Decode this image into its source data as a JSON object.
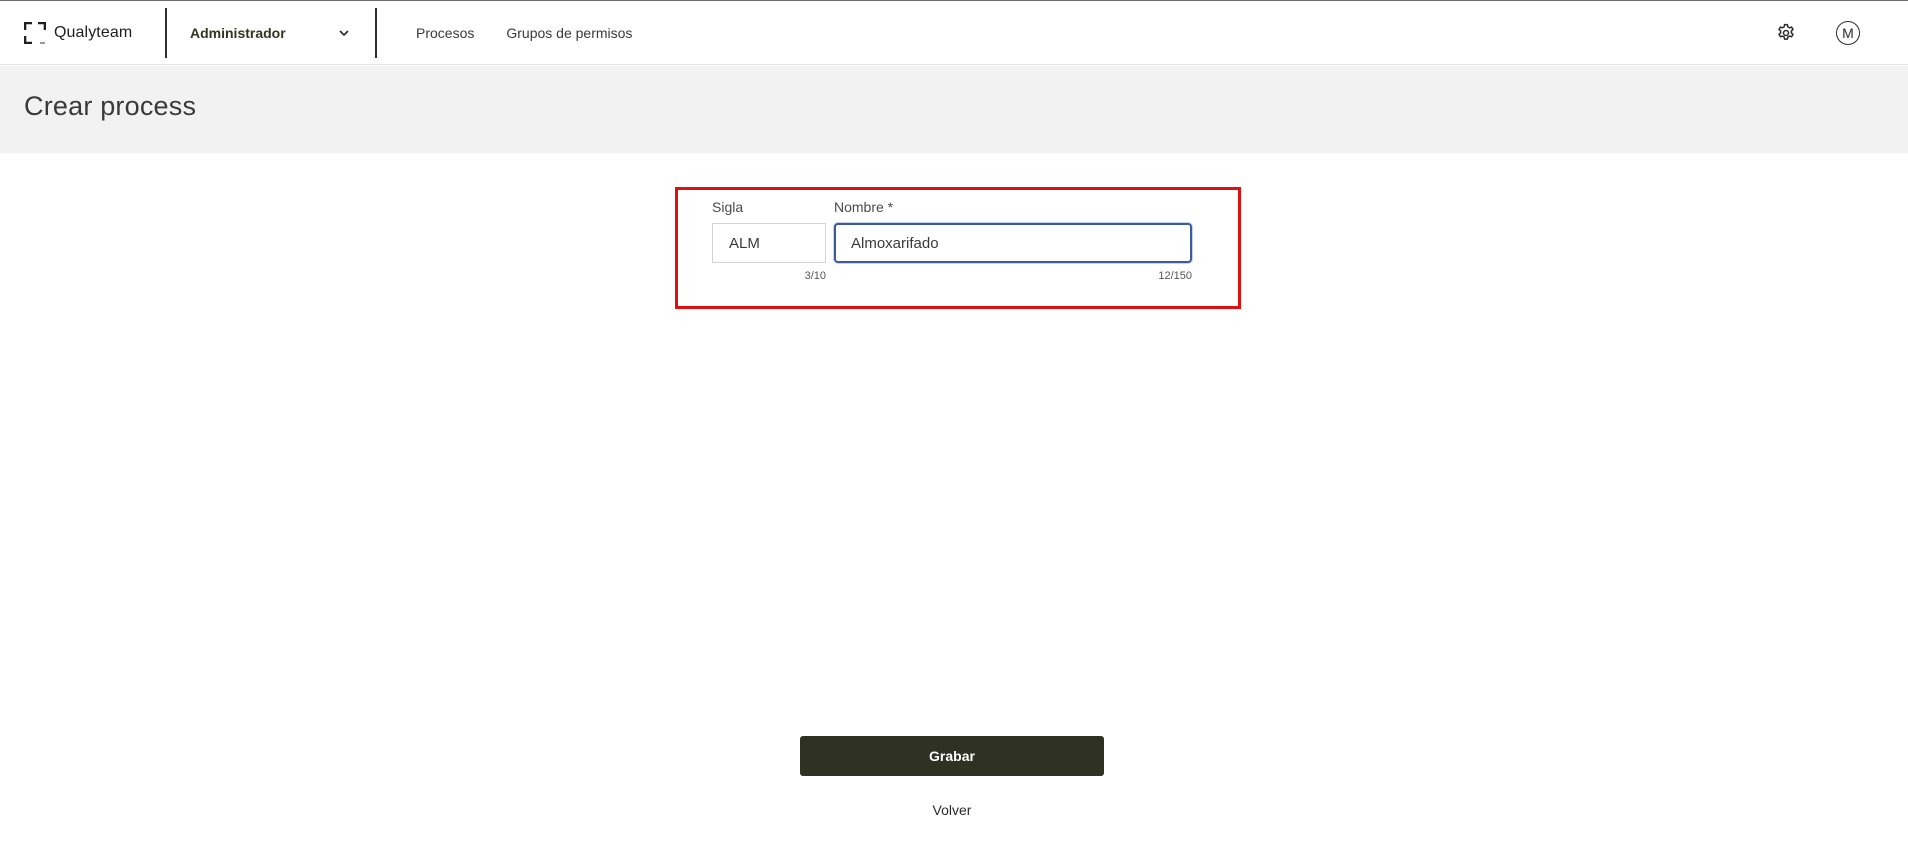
{
  "app": {
    "brand_name": "Qualyteam",
    "role_selector": {
      "value": "Administrador"
    },
    "nav": [
      {
        "label": "Procesos"
      },
      {
        "label": "Grupos de permisos"
      }
    ],
    "user_avatar_initial": "M",
    "icons": {
      "logo": "qualyteam-logo-icon",
      "role_chevron": "chevron-down-icon",
      "settings": "gear-icon"
    }
  },
  "page": {
    "title": "Crear process"
  },
  "form": {
    "sigla": {
      "label": "Sigla",
      "value": "ALM",
      "counter": "3/10"
    },
    "nombre": {
      "label": "Nombre *",
      "value": "Almoxarifado",
      "counter": "12/150"
    }
  },
  "actions": {
    "save_label": "Grabar",
    "back_label": "Volver"
  },
  "colors": {
    "highlight": "#e01010",
    "primary_button": "#2f3122",
    "focus_border": "#3d5a9a",
    "header_band": "#f2f2f2"
  }
}
